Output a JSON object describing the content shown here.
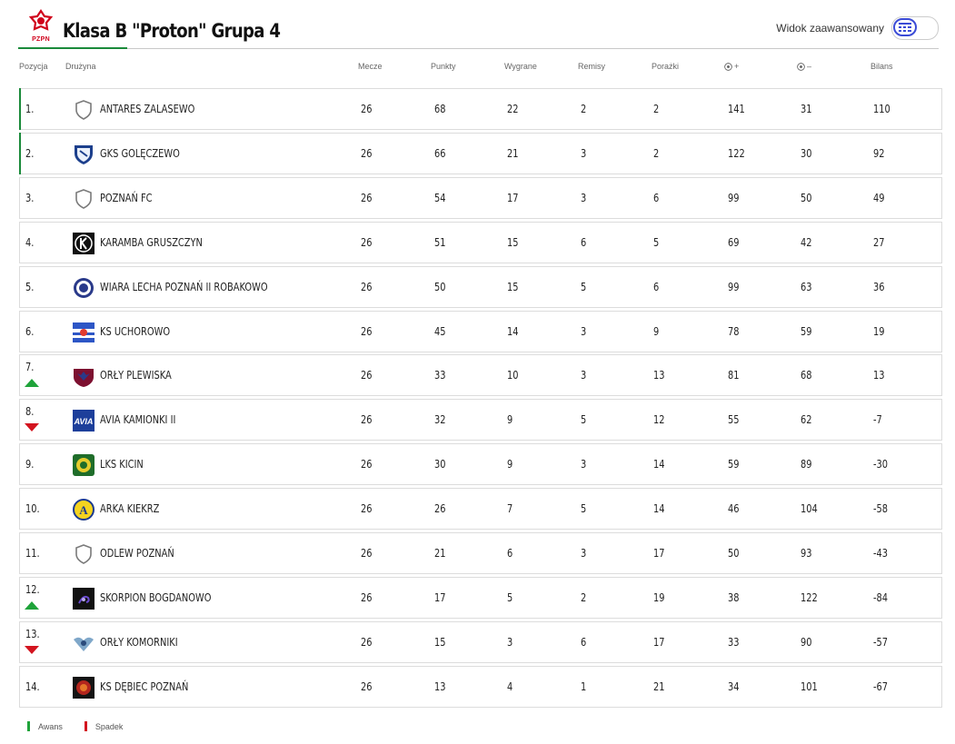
{
  "header": {
    "logo_text": "PZPN",
    "title": "Klasa B \"Proton\" Grupa 4",
    "advanced_view_label": "Widok zaawansowany"
  },
  "columns": {
    "position": "Pozycja",
    "team": "Drużyna",
    "matches": "Mecze",
    "points": "Punkty",
    "wins": "Wygrane",
    "draws": "Remisy",
    "losses": "Porażki",
    "goals_for": "+",
    "goals_against": "–",
    "balance": "Bilans"
  },
  "rows": [
    {
      "pos": "1.",
      "team": "Antares Zalasewo",
      "m": "26",
      "p": "68",
      "w": "22",
      "d": "2",
      "l": "2",
      "gf": "141",
      "ga": "31",
      "b": "110",
      "zone": "promotion",
      "trend": "",
      "crest": "shield-placeholder"
    },
    {
      "pos": "2.",
      "team": "GKS Golęczewo",
      "m": "26",
      "p": "66",
      "w": "21",
      "d": "3",
      "l": "2",
      "gf": "122",
      "ga": "30",
      "b": "92",
      "zone": "promotion",
      "trend": "",
      "crest": "blue-white-shield"
    },
    {
      "pos": "3.",
      "team": "Poznań FC",
      "m": "26",
      "p": "54",
      "w": "17",
      "d": "3",
      "l": "6",
      "gf": "99",
      "ga": "50",
      "b": "49",
      "zone": "",
      "trend": "",
      "crest": "shield-placeholder"
    },
    {
      "pos": "4.",
      "team": "Karamba Gruszczyn",
      "m": "26",
      "p": "51",
      "w": "15",
      "d": "6",
      "l": "5",
      "gf": "69",
      "ga": "42",
      "b": "27",
      "zone": "",
      "trend": "",
      "crest": "black-k"
    },
    {
      "pos": "5.",
      "team": "Wiara Lecha Poznań II Robakowo",
      "m": "26",
      "p": "50",
      "w": "15",
      "d": "5",
      "l": "6",
      "gf": "99",
      "ga": "63",
      "b": "36",
      "zone": "",
      "trend": "",
      "crest": "navy-circle"
    },
    {
      "pos": "6.",
      "team": "KS Uchorowo",
      "m": "26",
      "p": "45",
      "w": "14",
      "d": "3",
      "l": "9",
      "gf": "78",
      "ga": "59",
      "b": "19",
      "zone": "",
      "trend": "",
      "crest": "blue-red-stripes"
    },
    {
      "pos": "7.",
      "team": "Orły Plewiska",
      "m": "26",
      "p": "33",
      "w": "10",
      "d": "3",
      "l": "13",
      "gf": "81",
      "ga": "68",
      "b": "13",
      "zone": "",
      "trend": "up",
      "crest": "maroon-eagle"
    },
    {
      "pos": "8.",
      "team": "Avia Kamionki II",
      "m": "26",
      "p": "32",
      "w": "9",
      "d": "5",
      "l": "12",
      "gf": "55",
      "ga": "62",
      "b": "-7",
      "zone": "",
      "trend": "down",
      "crest": "avia-blue"
    },
    {
      "pos": "9.",
      "team": "LKS Kicin",
      "m": "26",
      "p": "30",
      "w": "9",
      "d": "3",
      "l": "14",
      "gf": "59",
      "ga": "89",
      "b": "-30",
      "zone": "",
      "trend": "",
      "crest": "green-yellow"
    },
    {
      "pos": "10.",
      "team": "Arka Kiekrz",
      "m": "26",
      "p": "26",
      "w": "7",
      "d": "5",
      "l": "14",
      "gf": "46",
      "ga": "104",
      "b": "-58",
      "zone": "",
      "trend": "",
      "crest": "yellow-a"
    },
    {
      "pos": "11.",
      "team": "Odlew Poznań",
      "m": "26",
      "p": "21",
      "w": "6",
      "d": "3",
      "l": "17",
      "gf": "50",
      "ga": "93",
      "b": "-43",
      "zone": "",
      "trend": "",
      "crest": "shield-placeholder"
    },
    {
      "pos": "12.",
      "team": "Skorpion Bogdanowo",
      "m": "26",
      "p": "17",
      "w": "5",
      "d": "2",
      "l": "19",
      "gf": "38",
      "ga": "122",
      "b": "-84",
      "zone": "",
      "trend": "up",
      "crest": "black-scorpion"
    },
    {
      "pos": "13.",
      "team": "Orły Komorniki",
      "m": "26",
      "p": "15",
      "w": "3",
      "d": "6",
      "l": "17",
      "gf": "33",
      "ga": "90",
      "b": "-57",
      "zone": "",
      "trend": "down",
      "crest": "grey-eagle"
    },
    {
      "pos": "14.",
      "team": "KS Dębiec Poznań",
      "m": "26",
      "p": "13",
      "w": "4",
      "d": "1",
      "l": "21",
      "gf": "34",
      "ga": "101",
      "b": "-67",
      "zone": "",
      "trend": "",
      "crest": "black-lion"
    }
  ],
  "legend": {
    "promotion_label": "Awans",
    "relegation_label": "Spadek"
  },
  "colors": {
    "promotion": "#1a8a3a",
    "relegation": "#d3141f",
    "accent": "#3b4bd6",
    "trend_up": "#1fa33a",
    "trend_down": "#d3141f"
  }
}
